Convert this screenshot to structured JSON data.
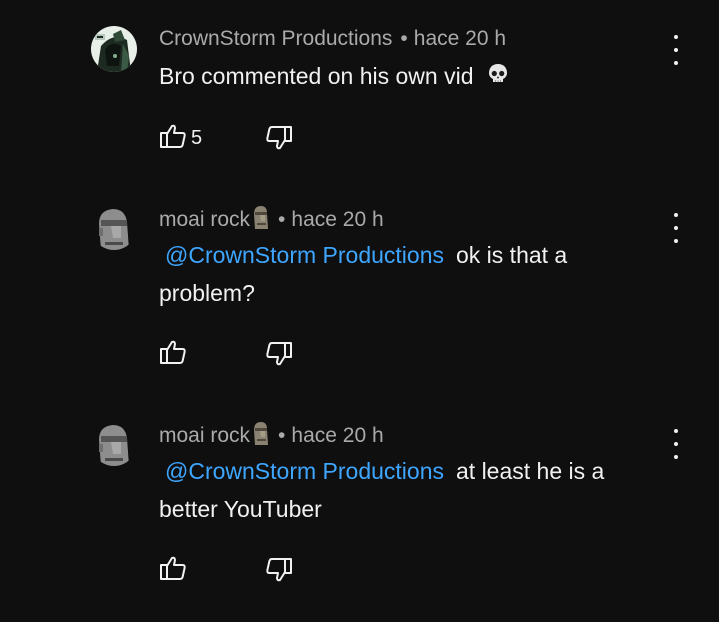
{
  "comments": [
    {
      "author": "CrownStorm Productions",
      "author_emoji": "",
      "time": "hace 20 h",
      "mention": "",
      "text": "Bro commented on his own vid",
      "text_emoji": "skull-emoji",
      "likes": "5",
      "avatar": "crownstorm-avatar"
    },
    {
      "author": "moai rock",
      "author_emoji": "moai-emoji",
      "time": "hace 20 h",
      "mention": "@CrownStorm Productions",
      "text": "ok is that a problem?",
      "likes": "",
      "avatar": "moai-avatar"
    },
    {
      "author": "moai rock",
      "author_emoji": "moai-emoji",
      "time": "hace 20 h",
      "mention": "@CrownStorm Productions",
      "text": "at least he is a better YouTuber",
      "likes": "",
      "avatar": "moai-avatar"
    }
  ],
  "colors": {
    "background": "#0f0f0f",
    "meta_text": "#aaaaaa",
    "body_text": "#f1f1f1",
    "mention": "#3ea6ff"
  },
  "icons": {
    "like": "thumbs-up-icon",
    "dislike": "thumbs-down-icon",
    "more": "more-vertical-icon"
  }
}
